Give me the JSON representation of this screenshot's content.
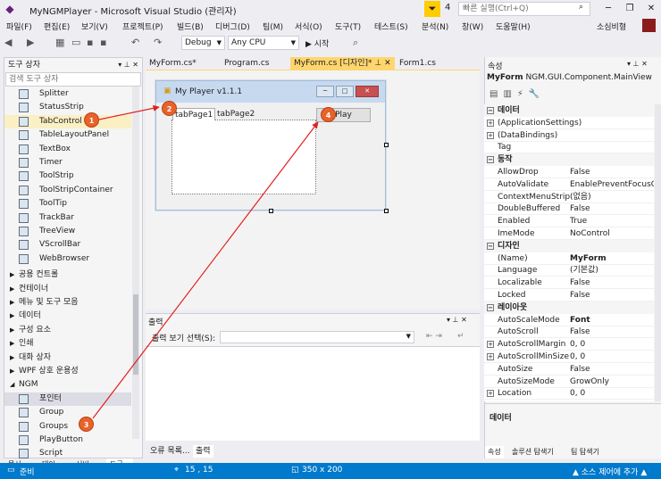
{
  "window": {
    "title": "MyNGMPlayer - Microsoft Visual Studio (관리자)",
    "notification_count": "4",
    "quick_launch_placeholder": "빠른 실행(Ctrl+Q)",
    "account_name": "소심비형"
  },
  "menu": [
    "파일(F)",
    "편집(E)",
    "보기(V)",
    "프로젝트(P)",
    "빌드(B)",
    "디버그(D)",
    "팀(M)",
    "서식(O)",
    "도구(T)",
    "테스트(S)",
    "분석(N)",
    "창(W)",
    "도움말(H)"
  ],
  "toolbar": {
    "config": "Debug",
    "platform": "Any CPU",
    "start_label": "▶ 시작"
  },
  "toolbox": {
    "title": "도구 상자",
    "search_placeholder": "검색 도구 상자",
    "items": [
      {
        "label": "Splitter",
        "icon": "splitter-icon"
      },
      {
        "label": "StatusStrip",
        "icon": "statusstrip-icon"
      },
      {
        "label": "TabControl",
        "icon": "tabcontrol-icon"
      },
      {
        "label": "TableLayoutPanel",
        "icon": "tablelayout-icon"
      },
      {
        "label": "TextBox",
        "icon": "textbox-icon"
      },
      {
        "label": "Timer",
        "icon": "timer-icon"
      },
      {
        "label": "ToolStrip",
        "icon": "toolstrip-icon"
      },
      {
        "label": "ToolStripContainer",
        "icon": "toolstripcontainer-icon"
      },
      {
        "label": "ToolTip",
        "icon": "tooltip-icon"
      },
      {
        "label": "TrackBar",
        "icon": "trackbar-icon"
      },
      {
        "label": "TreeView",
        "icon": "treeview-icon"
      },
      {
        "label": "VScrollBar",
        "icon": "vscrollbar-icon"
      },
      {
        "label": "WebBrowser",
        "icon": "webbrowser-icon"
      }
    ],
    "categories": [
      "공용 컨트롤",
      "컨테이너",
      "메뉴 및 도구 모음",
      "데이터",
      "구성 요소",
      "인쇄",
      "대화 상자",
      "WPF 상호 운용성"
    ],
    "ngm_category": "NGM",
    "ngm_items": [
      "포인터",
      "Group",
      "Groups",
      "PlayButton",
      "Script"
    ],
    "bottom_tabs": [
      "문서...",
      "데이...",
      "서버...",
      "도구..."
    ]
  },
  "doc_tabs": [
    "MyForm.cs*",
    "Program.cs",
    "MyForm.cs [디자인]*",
    "Form1.cs"
  ],
  "form": {
    "title": "My Player v1.1.1",
    "tab1": "tabPage1",
    "tab2": "tabPage2",
    "button": "Play"
  },
  "output": {
    "title": "출력",
    "source_label": "출력 보기 선택(S):",
    "tabs": [
      "오류 목록...",
      "출력"
    ]
  },
  "properties": {
    "title": "속성",
    "object_name": "MyForm",
    "object_type": "NGM.GUI.Component.MainView",
    "rows": [
      {
        "kind": "cat",
        "key": "데이터"
      },
      {
        "kind": "exp",
        "key": "(ApplicationSettings)",
        "value": ""
      },
      {
        "kind": "exp",
        "key": "(DataBindings)",
        "value": ""
      },
      {
        "kind": "row",
        "key": "Tag",
        "value": ""
      },
      {
        "kind": "cat",
        "key": "동작"
      },
      {
        "kind": "row",
        "key": "AllowDrop",
        "value": "False"
      },
      {
        "kind": "row",
        "key": "AutoValidate",
        "value": "EnablePreventFocusC"
      },
      {
        "kind": "row",
        "key": "ContextMenuStrip",
        "value": "(없음)"
      },
      {
        "kind": "row",
        "key": "DoubleBuffered",
        "value": "False"
      },
      {
        "kind": "row",
        "key": "Enabled",
        "value": "True"
      },
      {
        "kind": "row",
        "key": "ImeMode",
        "value": "NoControl"
      },
      {
        "kind": "cat",
        "key": "디자인"
      },
      {
        "kind": "row",
        "key": "(Name)",
        "value": "MyForm",
        "bold": true
      },
      {
        "kind": "row",
        "key": "Language",
        "value": "(기본값)"
      },
      {
        "kind": "row",
        "key": "Localizable",
        "value": "False"
      },
      {
        "kind": "row",
        "key": "Locked",
        "value": "False"
      },
      {
        "kind": "cat",
        "key": "레이아웃"
      },
      {
        "kind": "row",
        "key": "AutoScaleMode",
        "value": "Font",
        "bold": true
      },
      {
        "kind": "row",
        "key": "AutoScroll",
        "value": "False"
      },
      {
        "kind": "exp",
        "key": "AutoScrollMargin",
        "value": "0, 0"
      },
      {
        "kind": "exp",
        "key": "AutoScrollMinSize",
        "value": "0, 0"
      },
      {
        "kind": "row",
        "key": "AutoSize",
        "value": "False"
      },
      {
        "kind": "row",
        "key": "AutoSizeMode",
        "value": "GrowOnly"
      },
      {
        "kind": "exp",
        "key": "Location",
        "value": "0, 0"
      }
    ],
    "description": "데이터",
    "bottom_tabs": [
      "속성",
      "솔루션 탐색기",
      "팀 탐색기"
    ]
  },
  "status": {
    "ready": "준비",
    "position": "15 , 15",
    "size": "350 x 200",
    "source_control": "▲ 소스 제어에 추가 ▲"
  },
  "callouts": [
    "1",
    "2",
    "3",
    "4"
  ],
  "colors": {
    "accent": "#007acc",
    "callout": "#e9622a",
    "arrow": "#e02020",
    "highlight": "#fbefc4"
  }
}
